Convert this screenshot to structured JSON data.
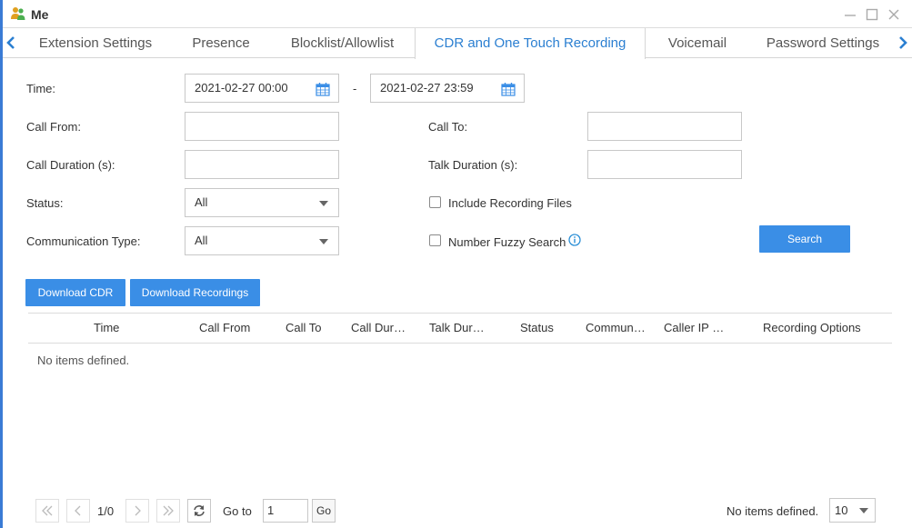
{
  "window": {
    "title": "Me"
  },
  "tabs": [
    {
      "label": "Extension Settings"
    },
    {
      "label": "Presence"
    },
    {
      "label": "Blocklist/Allowlist"
    },
    {
      "label": "CDR and One Touch Recording",
      "active": true
    },
    {
      "label": "Voicemail"
    },
    {
      "label": "Password Settings"
    }
  ],
  "filters": {
    "time_label": "Time:",
    "time_from": "2021-02-27 00:00",
    "time_separator": "-",
    "time_to": "2021-02-27 23:59",
    "call_from_label": "Call From:",
    "call_from_value": "",
    "call_to_label": "Call To:",
    "call_to_value": "",
    "call_duration_label": "Call Duration (s):",
    "call_duration_value": "",
    "talk_duration_label": "Talk Duration (s):",
    "talk_duration_value": "",
    "status_label": "Status:",
    "status_value": "All",
    "comm_type_label": "Communication Type:",
    "comm_type_value": "All",
    "include_recording_label": "Include Recording Files",
    "include_recording_checked": false,
    "fuzzy_search_label": "Number Fuzzy Search",
    "fuzzy_search_checked": false,
    "search_button": "Search"
  },
  "actions": {
    "download_cdr": "Download CDR",
    "download_recordings": "Download Recordings"
  },
  "table": {
    "columns": [
      "Time",
      "Call From",
      "Call To",
      "Call Dur…",
      "Talk Dur…",
      "Status",
      "Commun…",
      "Caller IP …",
      "Recording Options"
    ],
    "empty_text": "No items defined."
  },
  "pager": {
    "page_info": "1/0",
    "goto_label": "Go to",
    "goto_value": "1",
    "go_button": "Go",
    "status_text": "No items defined.",
    "page_size": "10"
  },
  "colors": {
    "accent": "#3a8ee6",
    "active_tab_text": "#2b7fd1",
    "window_border": "#3a7bd5"
  }
}
